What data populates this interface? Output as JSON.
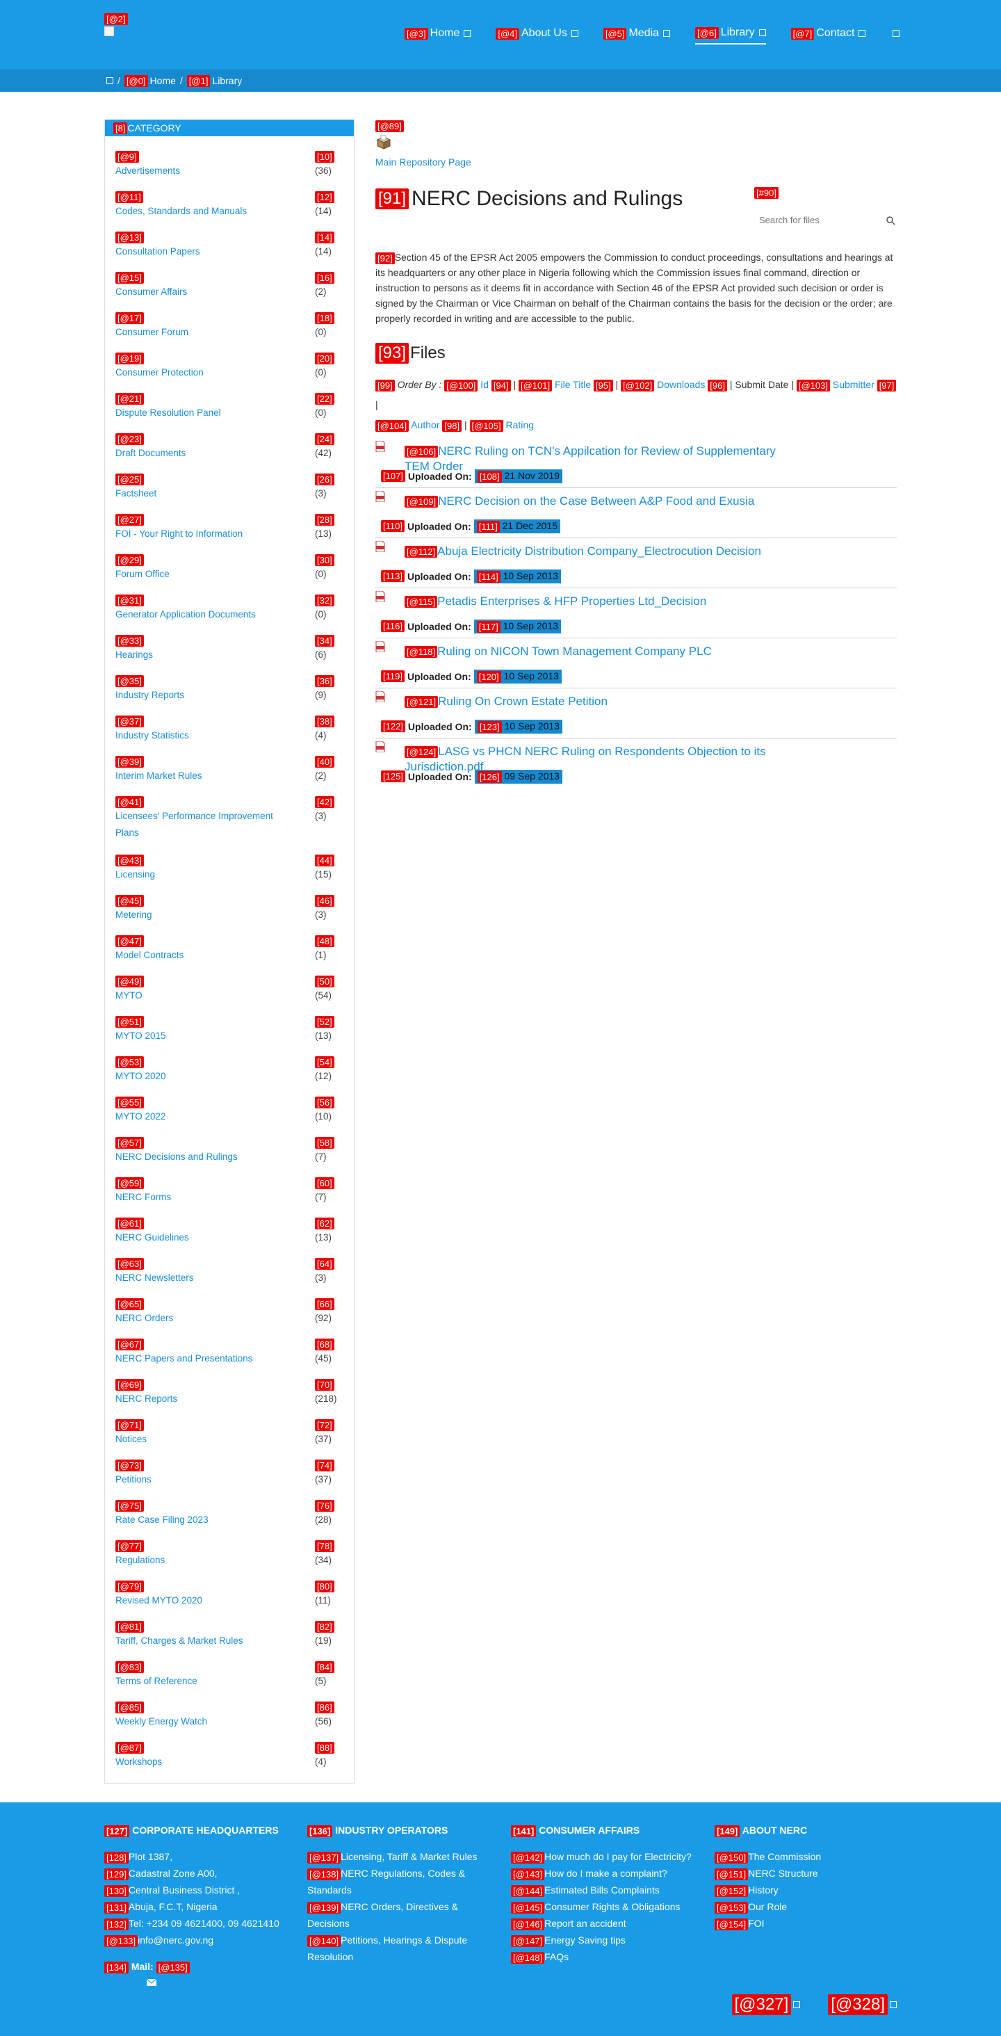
{
  "header": {
    "logo_tag": "[@2]",
    "nav": [
      {
        "tag": "[@3]",
        "label": "Home"
      },
      {
        "tag": "[@4]",
        "label": "About Us"
      },
      {
        "tag": "[@5]",
        "label": "Media"
      },
      {
        "tag": "[@6]",
        "label": "Library"
      },
      {
        "tag": "[@7]",
        "label": "Contact"
      }
    ]
  },
  "breadcrumb": {
    "sep": "/",
    "home": {
      "tag": "[@0]",
      "label": "Home"
    },
    "library": {
      "tag": "[@1]",
      "label": "Library"
    }
  },
  "sidebar": {
    "header_tag": "[8]",
    "header": "CATEGORY",
    "items": [
      {
        "tag": "[@9]",
        "name": "Advertisements",
        "count_tag": "[10]",
        "count": "(36)"
      },
      {
        "tag": "[@11]",
        "name": "Codes, Standards and Manuals",
        "count_tag": "[12]",
        "count": "(14)"
      },
      {
        "tag": "[@13]",
        "name": "Consultation Papers",
        "count_tag": "[14]",
        "count": "(14)"
      },
      {
        "tag": "[@15]",
        "name": "Consumer Affairs",
        "count_tag": "[16]",
        "count": "(2)"
      },
      {
        "tag": "[@17]",
        "name": "Consumer Forum",
        "count_tag": "[18]",
        "count": "(0)"
      },
      {
        "tag": "[@19]",
        "name": "Consumer Protection",
        "count_tag": "[20]",
        "count": "(0)"
      },
      {
        "tag": "[@21]",
        "name": "Dispute Resolution Panel",
        "count_tag": "[22]",
        "count": "(0)"
      },
      {
        "tag": "[@23]",
        "name": "Draft Documents",
        "count_tag": "[24]",
        "count": "(42)"
      },
      {
        "tag": "[@25]",
        "name": "Factsheet",
        "count_tag": "[26]",
        "count": "(3)"
      },
      {
        "tag": "[@27]",
        "name": "FOI - Your Right to Information",
        "count_tag": "[28]",
        "count": "(13)"
      },
      {
        "tag": "[@29]",
        "name": "Forum Office",
        "count_tag": "[30]",
        "count": "(0)"
      },
      {
        "tag": "[@31]",
        "name": "Generator Application Documents",
        "count_tag": "[32]",
        "count": "(0)"
      },
      {
        "tag": "[@33]",
        "name": "Hearings",
        "count_tag": "[34]",
        "count": "(6)"
      },
      {
        "tag": "[@35]",
        "name": "Industry Reports",
        "count_tag": "[36]",
        "count": "(9)"
      },
      {
        "tag": "[@37]",
        "name": "Industry Statistics",
        "count_tag": "[38]",
        "count": "(4)"
      },
      {
        "tag": "[@39]",
        "name": "Interim Market Rules",
        "count_tag": "[40]",
        "count": "(2)"
      },
      {
        "tag": "[@41]",
        "name": "Licensees' Performance Improvement Plans",
        "count_tag": "[42]",
        "count": "(3)"
      },
      {
        "tag": "[@43]",
        "name": "Licensing",
        "count_tag": "[44]",
        "count": "(15)"
      },
      {
        "tag": "[@45]",
        "name": "Metering",
        "count_tag": "[46]",
        "count": "(3)"
      },
      {
        "tag": "[@47]",
        "name": "Model Contracts",
        "count_tag": "[48]",
        "count": "(1)"
      },
      {
        "tag": "[@49]",
        "name": "MYTO",
        "count_tag": "[50]",
        "count": "(54)"
      },
      {
        "tag": "[@51]",
        "name": "MYTO 2015",
        "count_tag": "[52]",
        "count": "(13)"
      },
      {
        "tag": "[@53]",
        "name": "MYTO 2020",
        "count_tag": "[54]",
        "count": "(12)"
      },
      {
        "tag": "[@55]",
        "name": "MYTO 2022",
        "count_tag": "[56]",
        "count": "(10)"
      },
      {
        "tag": "[@57]",
        "name": "NERC Decisions and Rulings",
        "count_tag": "[58]",
        "count": "(7)"
      },
      {
        "tag": "[@59]",
        "name": "NERC Forms",
        "count_tag": "[60]",
        "count": "(7)"
      },
      {
        "tag": "[@61]",
        "name": "NERC Guidelines",
        "count_tag": "[62]",
        "count": "(13)"
      },
      {
        "tag": "[@63]",
        "name": "NERC Newsletters",
        "count_tag": "[64]",
        "count": "(3)"
      },
      {
        "tag": "[@65]",
        "name": "NERC Orders",
        "count_tag": "[66]",
        "count": "(92)"
      },
      {
        "tag": "[@67]",
        "name": "NERC Papers and Presentations",
        "count_tag": "[68]",
        "count": "(45)"
      },
      {
        "tag": "[@69]",
        "name": "NERC Reports",
        "count_tag": "[70]",
        "count": "(218)"
      },
      {
        "tag": "[@71]",
        "name": "Notices",
        "count_tag": "[72]",
        "count": "(37)"
      },
      {
        "tag": "[@73]",
        "name": "Petitions",
        "count_tag": "[74]",
        "count": "(37)"
      },
      {
        "tag": "[@75]",
        "name": "Rate Case Filing 2023",
        "count_tag": "[76]",
        "count": "(28)"
      },
      {
        "tag": "[@77]",
        "name": "Regulations",
        "count_tag": "[78]",
        "count": "(34)"
      },
      {
        "tag": "[@79]",
        "name": "Revised MYTO 2020",
        "count_tag": "[80]",
        "count": "(11)"
      },
      {
        "tag": "[@81]",
        "name": "Tariff, Charges & Market Rules",
        "count_tag": "[82]",
        "count": "(19)"
      },
      {
        "tag": "[@83]",
        "name": "Terms of Reference",
        "count_tag": "[84]",
        "count": "(5)"
      },
      {
        "tag": "[@85]",
        "name": "Weekly Energy Watch",
        "count_tag": "[86]",
        "count": "(56)"
      },
      {
        "tag": "[@87]",
        "name": "Workshops",
        "count_tag": "[88]",
        "count": "(4)"
      }
    ]
  },
  "main": {
    "repo_tag": "[@89]",
    "repo_link": "Main Repository Page",
    "title_tag": "[91]",
    "title": "NERC Decisions and Rulings",
    "side_tag": "[#90]",
    "search_placeholder": "Search for files",
    "desc_tag": "[92]",
    "description": "Section 45 of the EPSR Act 2005 empowers the Commission to conduct proceedings, consultations and hearings at its headquarters or any other place in Nigeria following which the Commission issues final command, direction or instruction to persons as it deems fit in accordance with Section 46 of the EPSR Act provided such decision or order is signed by the Chairman or Vice Chairman on behalf of the Chairman contains the basis for the decision or the order; are properly recorded in writing and are accessible to the public.",
    "files_tag": "[93]",
    "files_heading": "Files",
    "order_by": {
      "tag": "[99]",
      "label": "Order By :",
      "sep": "|",
      "t100": "[@100]",
      "id": "Id",
      "t94": "[94]",
      "t101": "[@101]",
      "file_title": "File Title",
      "t95": "[95]",
      "t102": "[@102]",
      "downloads": "Downloads",
      "t96": "[96]",
      "submit_date": "Submit Date",
      "t103": "[@103]",
      "submitter": "Submitter",
      "t97": "[97]",
      "t104": "[@104]",
      "author": "Author",
      "t98": "[98]",
      "t105": "[@105]",
      "rating": "Rating"
    },
    "uploaded_label": "Uploaded On:",
    "documents": [
      {
        "tag": "[@106]",
        "title": "NERC Ruling on TCN's Appilcation for Review of Supplementary TEM Order",
        "meta_tag": "[107]",
        "date_tag": "[108]",
        "date": "21 Nov 2019"
      },
      {
        "tag": "[@109]",
        "title": "NERC Decision on the Case Between A&P Food and Exusia",
        "meta_tag": "[110]",
        "date_tag": "[111]",
        "date": "21 Dec 2015"
      },
      {
        "tag": "[@112]",
        "title": "Abuja Electricity Distribution Company_Electrocution Decision",
        "meta_tag": "[113]",
        "date_tag": "[114]",
        "date": "10 Sep 2013"
      },
      {
        "tag": "[@115]",
        "title": "Petadis Enterprises & HFP Properties Ltd_Decision",
        "meta_tag": "[116]",
        "date_tag": "[117]",
        "date": "10 Sep 2013"
      },
      {
        "tag": "[@118]",
        "title": "Ruling on NICON Town Management Company PLC",
        "meta_tag": "[119]",
        "date_tag": "[120]",
        "date": "10 Sep 2013"
      },
      {
        "tag": "[@121]",
        "title": "Ruling On Crown Estate Petition",
        "meta_tag": "[122]",
        "date_tag": "[123]",
        "date": "10 Sep 2013"
      },
      {
        "tag": "[@124]",
        "title": "LASG vs PHCN NERC Ruling on Respondents Objection to its Jurisdiction.pdf",
        "meta_tag": "[125]",
        "date_tag": "[126]",
        "date": "09 Sep 2013"
      }
    ]
  },
  "footer": {
    "col1": {
      "tag": "[127]",
      "heading": "CORPORATE HEADQUARTERS",
      "lines": [
        {
          "tag": "[128]",
          "text": "Plot 1387,"
        },
        {
          "tag": "[129]",
          "text": "Cadastral Zone A00,"
        },
        {
          "tag": "[130]",
          "text": "Central Business District ,"
        },
        {
          "tag": "[131]",
          "text": "Abuja, F.C.T, Nigeria"
        },
        {
          "tag": "[132]",
          "text": "Tel: +234 09 4621400, 09 4621410"
        },
        {
          "tag": "[@133]",
          "text": "info@nerc.gov.ng"
        }
      ],
      "mail_tag": "[134]",
      "mail_label": "Mail:",
      "mail_link_tag": "[@135]"
    },
    "col2": {
      "tag": "[136]",
      "heading": "INDUSTRY OPERATORS",
      "links": [
        {
          "tag": "[@137]",
          "text": "Licensing, Tariff & Market Rules"
        },
        {
          "tag": "[@138]",
          "text": "NERC Regulations, Codes & Standards"
        },
        {
          "tag": "[@139]",
          "text": "NERC Orders, Directives & Decisions"
        },
        {
          "tag": "[@140]",
          "text": "Petitions, Hearings & Dispute Resolution"
        }
      ]
    },
    "col3": {
      "tag": "[141]",
      "heading": "CONSUMER AFFAIRS",
      "links": [
        {
          "tag": "[@142]",
          "text": "How much do I pay for Electricity?"
        },
        {
          "tag": "[@143]",
          "text": "How do I make a complaint?"
        },
        {
          "tag": "[@144]",
          "text": "Estimated Bills Complaints"
        },
        {
          "tag": "[@145]",
          "text": "Consumer Rights & Obligations"
        },
        {
          "tag": "[@146]",
          "text": "Report an accident"
        },
        {
          "tag": "[@147]",
          "text": "Energy Saving tips"
        },
        {
          "tag": "[@148]",
          "text": "FAQs"
        }
      ]
    },
    "col4": {
      "tag": "[149]",
      "heading": "ABOUT NERC",
      "links": [
        {
          "tag": "[@150]",
          "text": "The Commission"
        },
        {
          "tag": "[@151]",
          "text": "NERC Structure"
        },
        {
          "tag": "[@152]",
          "text": "History"
        },
        {
          "tag": "[@153]",
          "text": "Our Role"
        },
        {
          "tag": "[@154]",
          "text": "FOI"
        }
      ]
    },
    "bottom": {
      "t327": "[@327]",
      "t328": "[@328]"
    }
  }
}
